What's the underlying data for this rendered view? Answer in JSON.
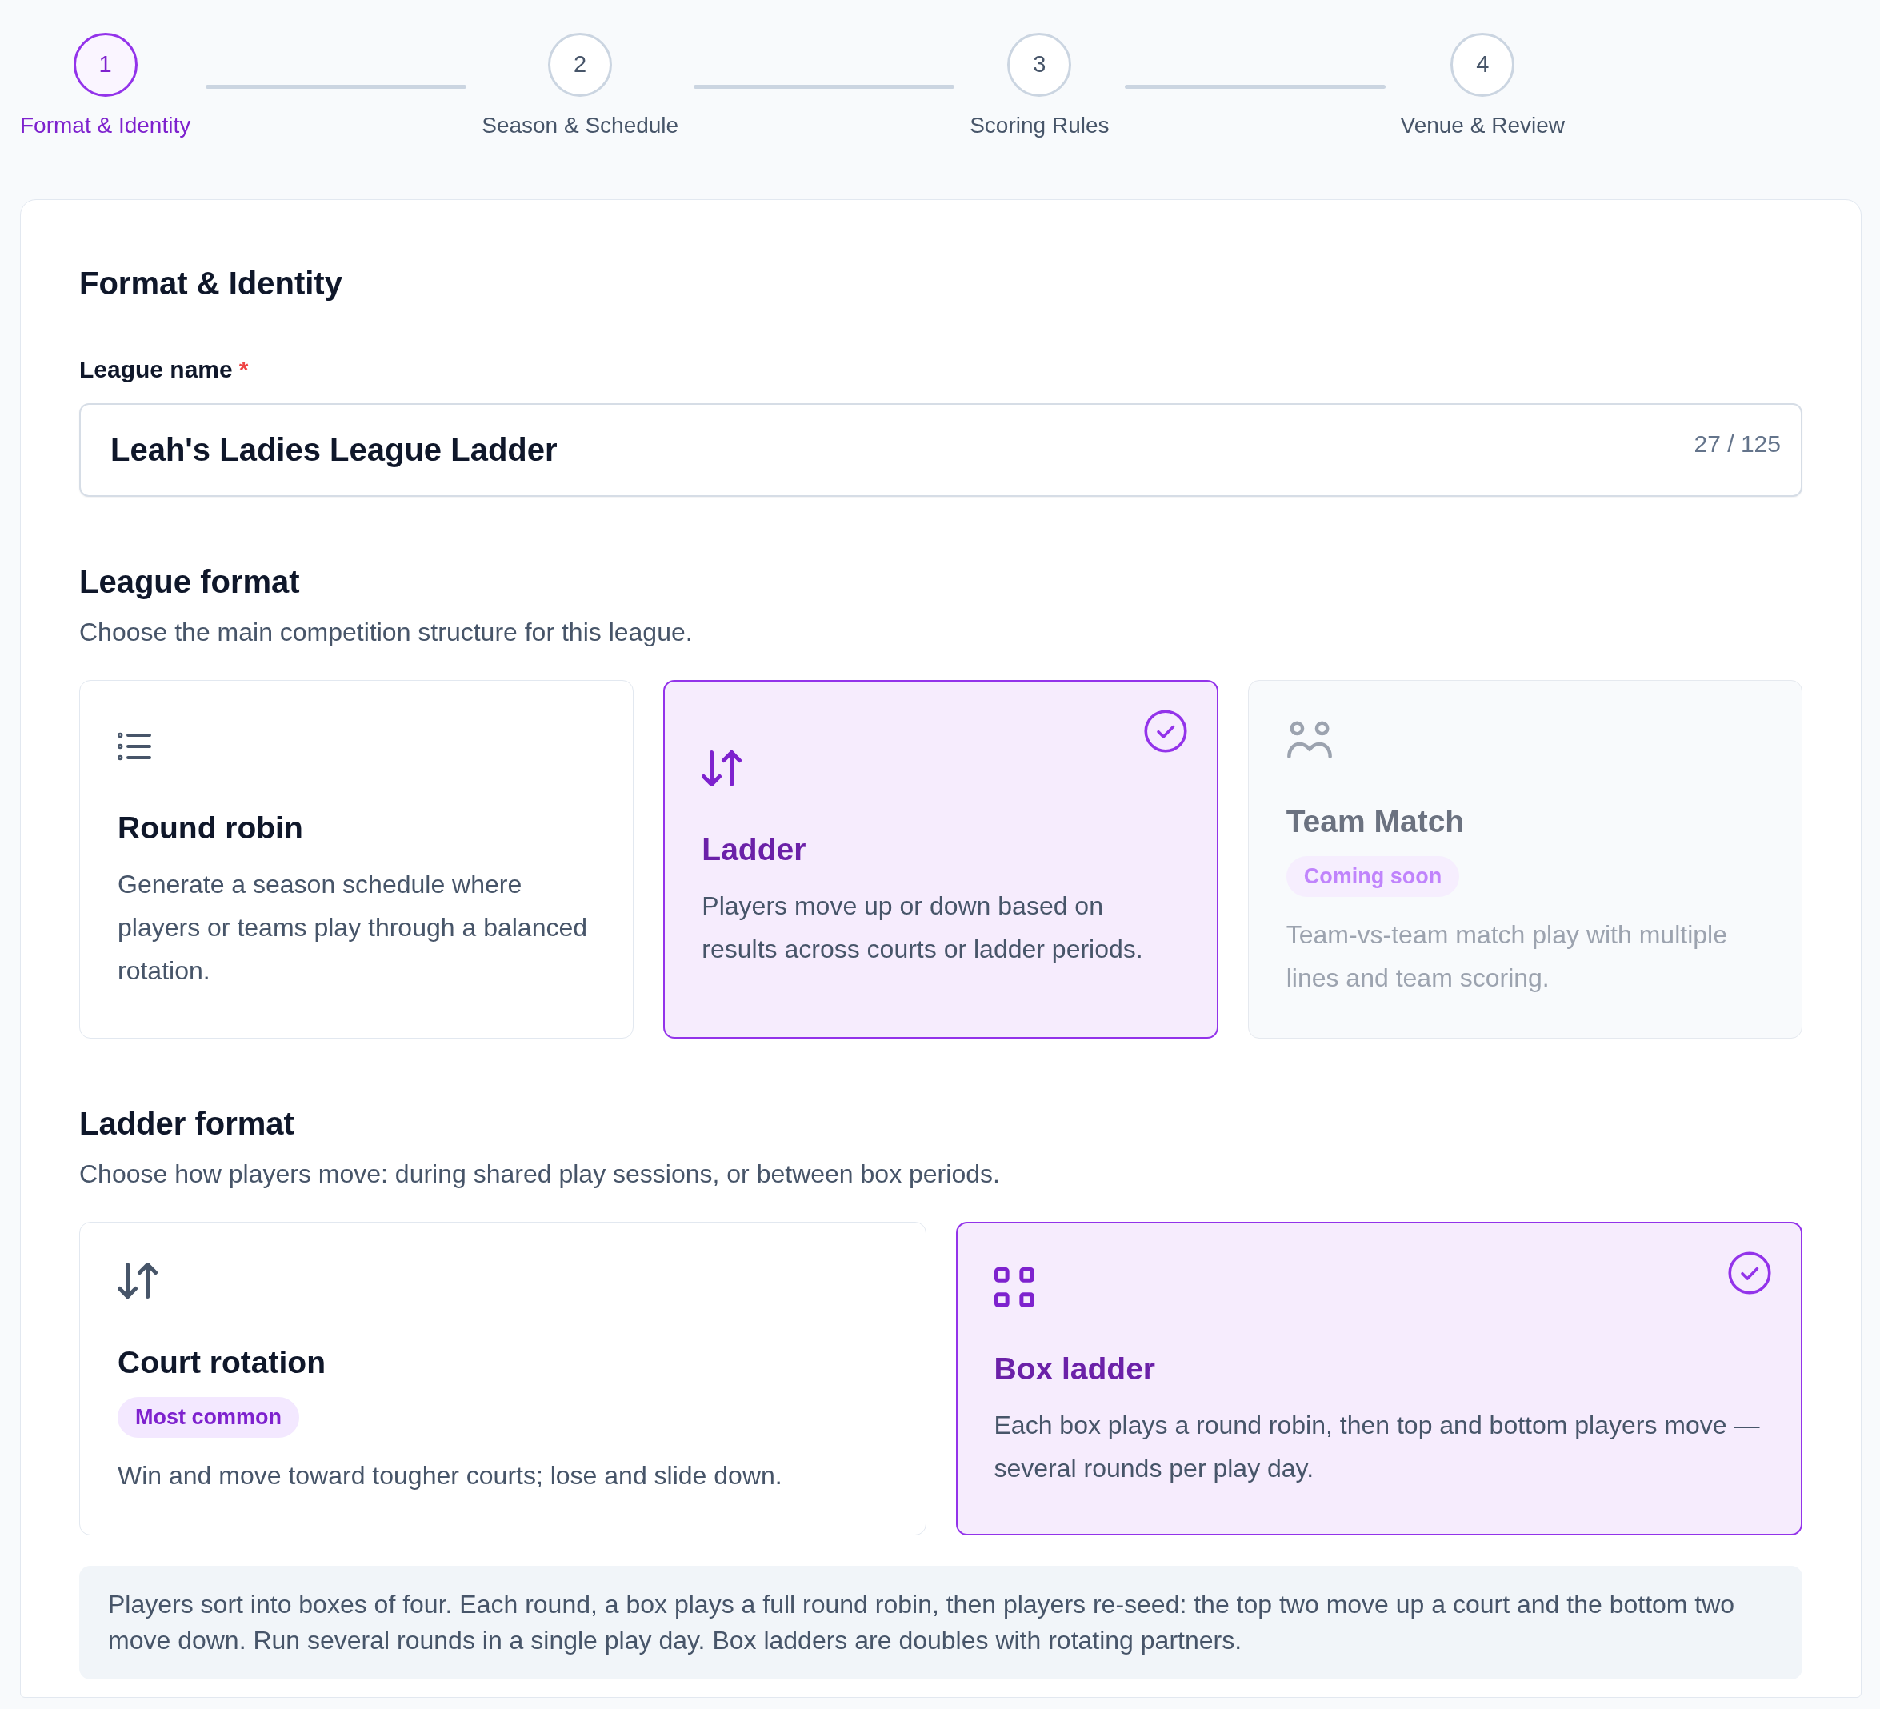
{
  "stepper": {
    "steps": [
      {
        "number": "1",
        "label": "Format & Identity",
        "selected": true
      },
      {
        "number": "2",
        "label": "Season & Schedule",
        "selected": false
      },
      {
        "number": "3",
        "label": "Scoring Rules",
        "selected": false
      },
      {
        "number": "4",
        "label": "Venue & Review",
        "selected": false
      }
    ]
  },
  "form": {
    "title": "Format & Identity",
    "league_name": {
      "label": "League name",
      "required_mark": "*",
      "value": "Leah's Ladies League Ladder",
      "counter": "27 / 125"
    },
    "league_format": {
      "heading": "League format",
      "description": "Choose the main competition structure for this league.",
      "options": [
        {
          "title": "Round robin",
          "description": "Generate a season schedule where players or teams play through a balanced rotation.",
          "selected": false,
          "disabled": false
        },
        {
          "title": "Ladder",
          "description": "Players move up or down based on results across courts or ladder periods.",
          "selected": true,
          "disabled": false
        },
        {
          "title": "Team Match",
          "badge": "Coming soon",
          "description": "Team-vs-team match play with multiple lines and team scoring.",
          "selected": false,
          "disabled": true
        }
      ]
    },
    "ladder_format": {
      "heading": "Ladder format",
      "description": "Choose how players move: during shared play sessions, or between box periods.",
      "options": [
        {
          "title": "Court rotation",
          "badge": "Most common",
          "description": "Win and move toward tougher courts; lose and slide down.",
          "selected": false,
          "disabled": false
        },
        {
          "title": "Box ladder",
          "description": "Each box plays a round robin, then top and bottom players move — several rounds per play day.",
          "selected": true,
          "disabled": false
        }
      ],
      "note": "Players sort into boxes of four. Each round, a box plays a full round robin, then players re-seed: the top two move up a court and the bottom two move down. Run several rounds in a single play day. Box ladders are doubles with rotating partners."
    }
  }
}
